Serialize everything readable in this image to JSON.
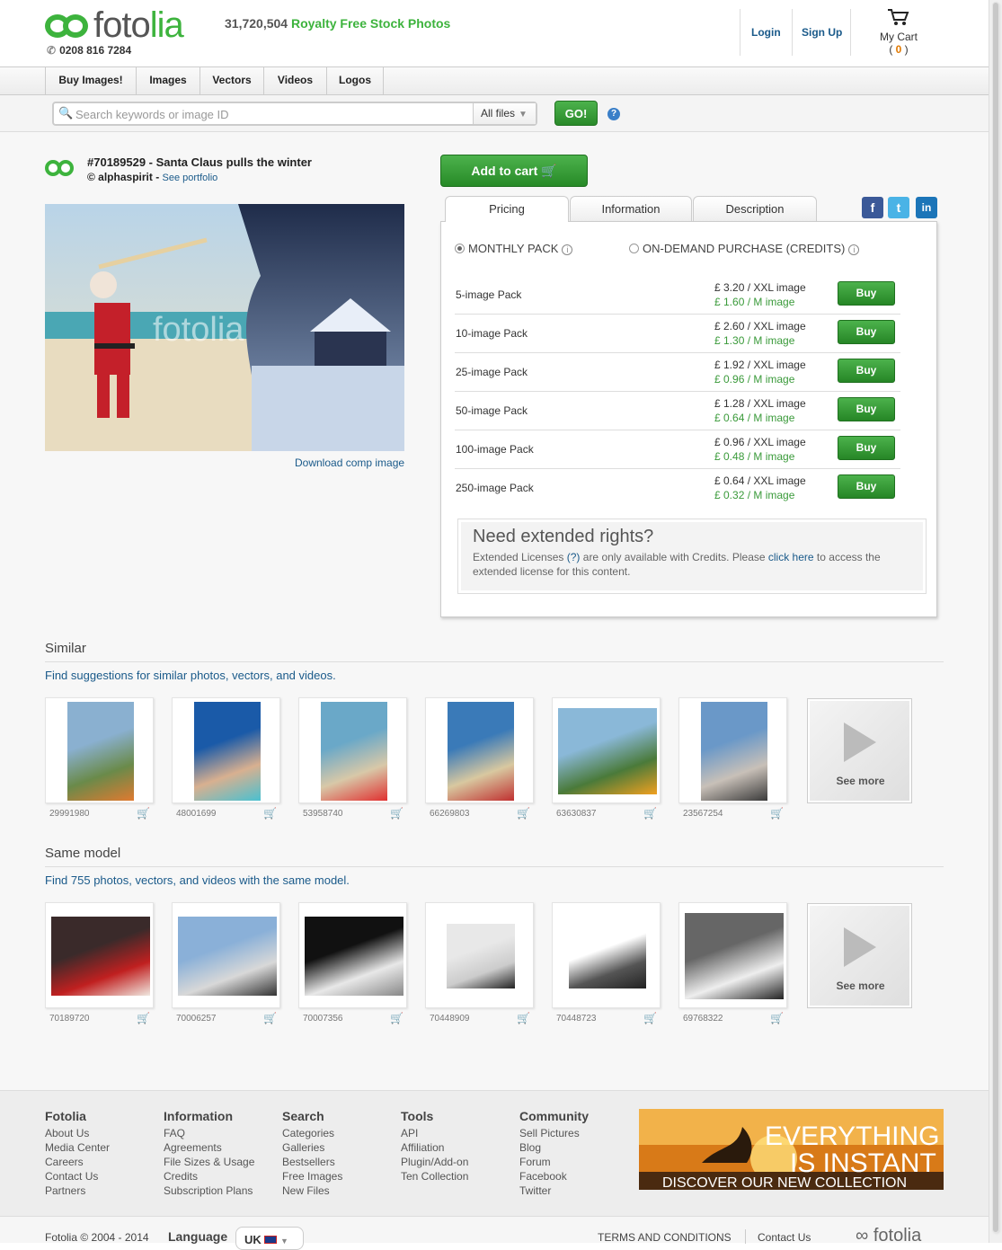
{
  "header": {
    "logo_word_a": "foto",
    "logo_word_b": "lia",
    "phone": "0208 816 7284",
    "tagline_count": "31,720,504",
    "tagline_text": "Royalty Free Stock Photos",
    "login": "Login",
    "signup": "Sign Up",
    "cart_label": "My Cart",
    "cart_count": "0"
  },
  "nav": {
    "items": [
      "Buy Images!",
      "Images",
      "Vectors",
      "Videos",
      "Logos"
    ]
  },
  "search": {
    "placeholder": "Search keywords or image ID",
    "filter": "All files",
    "go": "GO!",
    "help": "?"
  },
  "image": {
    "title": "#70189529 - Santa Claus pulls the winter",
    "author": "© alphaspirit -",
    "portfolio_link": "See portfolio",
    "download": "Download comp image",
    "watermark": "fotolia"
  },
  "purchase": {
    "add_to_cart": "Add to cart",
    "tabs": [
      "Pricing",
      "Information",
      "Description"
    ],
    "social": [
      "f",
      "t",
      "in"
    ],
    "mode_monthly": "MONTHLY PACK",
    "mode_credits": "ON-DEMAND PURCHASE (CREDITS)",
    "buy_label": "Buy",
    "packs": [
      {
        "name": "5-image Pack",
        "xxl": "£ 3.20 / XXL image",
        "m": "£ 1.60 / M image"
      },
      {
        "name": "10-image Pack",
        "xxl": "£ 2.60 / XXL image",
        "m": "£ 1.30 / M image"
      },
      {
        "name": "25-image Pack",
        "xxl": "£ 1.92 / XXL image",
        "m": "£ 0.96 / M image"
      },
      {
        "name": "50-image Pack",
        "xxl": "£ 1.28 / XXL image",
        "m": "£ 0.64 / M image"
      },
      {
        "name": "100-image Pack",
        "xxl": "£ 0.96 / XXL image",
        "m": "£ 0.48 / M image"
      },
      {
        "name": "250-image Pack",
        "xxl": "£ 0.64 / XXL image",
        "m": "£ 0.32 / M image"
      }
    ],
    "ext_title": "Need extended rights?",
    "ext_text_a": "Extended Licenses",
    "ext_q": "(?)",
    "ext_text_b": "are only available with Credits. Please",
    "ext_link": "click here",
    "ext_text_c": "to access the extended license for this content."
  },
  "similar": {
    "title": "Similar",
    "subtitle": "Find suggestions for similar photos, vectors, and videos.",
    "ids": [
      "29991980",
      "48001699",
      "53958740",
      "66269803",
      "63630837",
      "23567254"
    ],
    "see_more": "See more"
  },
  "same_model": {
    "title": "Same model",
    "subtitle": "Find 755 photos, vectors, and videos with the same model.",
    "ids": [
      "70189720",
      "70006257",
      "70007356",
      "70448909",
      "70448723",
      "69768322"
    ],
    "see_more": "See more"
  },
  "footer": {
    "columns": [
      {
        "title": "Fotolia",
        "links": [
          "About Us",
          "Media Center",
          "Careers",
          "Contact Us",
          "Partners"
        ]
      },
      {
        "title": "Information",
        "links": [
          "FAQ",
          "Agreements",
          "File Sizes & Usage",
          "Credits",
          "Subscription Plans"
        ]
      },
      {
        "title": "Search",
        "links": [
          "Categories",
          "Galleries",
          "Bestsellers",
          "Free Images",
          "New Files"
        ]
      },
      {
        "title": "Tools",
        "links": [
          "API",
          "Affiliation",
          "Plugin/Add-on",
          "Ten Collection"
        ]
      },
      {
        "title": "Community",
        "links": [
          "Sell Pictures",
          "Blog",
          "Forum",
          "Facebook",
          "Twitter"
        ]
      }
    ],
    "banner_line1": "EVERYTHING",
    "banner_line2": "IS INSTANT",
    "banner_line3": "DISCOVER OUR NEW COLLECTION",
    "copyright": "Fotolia © 2004 - 2014",
    "language_label": "Language",
    "language_value": "UK",
    "terms": "TERMS AND CONDITIONS",
    "contact": "Contact Us",
    "bottom_logo": "fotolia"
  }
}
